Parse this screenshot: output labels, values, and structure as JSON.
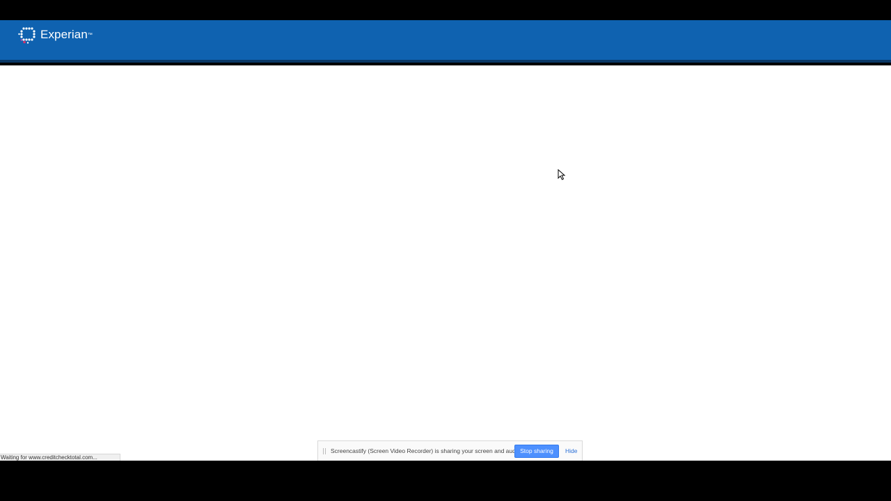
{
  "header": {
    "brand_name": "Experian",
    "brand_trademark": "™",
    "background_color": "#0f62b0"
  },
  "browser_status": {
    "text": "Waiting for www.creditchecktotal.com..."
  },
  "screen_share_bar": {
    "message": "Screencastify (Screen Video Recorder) is sharing your screen and audio.",
    "stop_button_label": "Stop sharing",
    "hide_link_label": "Hide",
    "button_color": "#4d90fe"
  },
  "icons": [
    "experian-logo-icon",
    "mouse-pointer-icon",
    "drag-grip-icon"
  ]
}
